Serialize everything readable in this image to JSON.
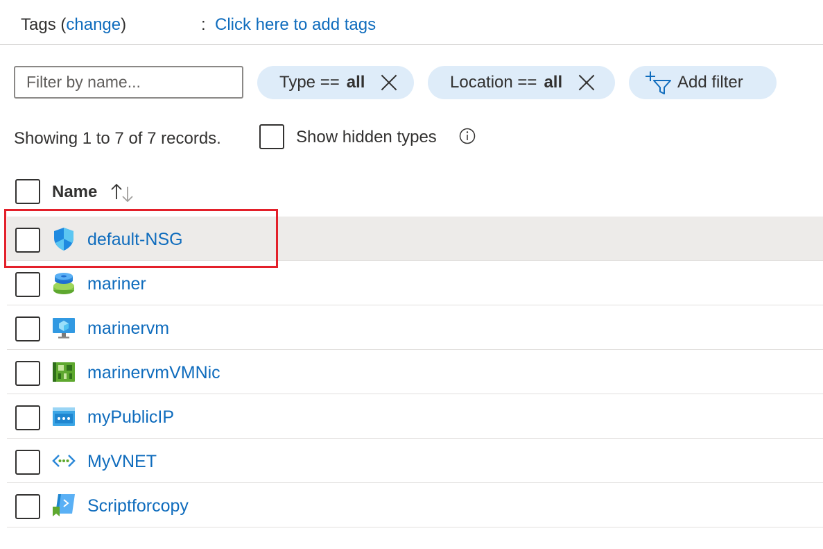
{
  "tags": {
    "label": "Tags",
    "open_paren": "(",
    "change_link": "change",
    "close_paren": ")",
    "colon": ":",
    "add_link": "Click here to add tags"
  },
  "filters": {
    "search_placeholder": "Filter by name...",
    "type_pill": {
      "key": "Type ==",
      "value": "all"
    },
    "location_pill": {
      "key": "Location ==",
      "value": "all"
    },
    "add_filter_label": "Add filter"
  },
  "summary": {
    "records_text": "Showing 1 to 7 of 7 records.",
    "show_hidden_label": "Show hidden types"
  },
  "table": {
    "column_name": "Name",
    "rows": [
      {
        "name": "default-NSG",
        "icon": "network-security-group-icon",
        "selected": true
      },
      {
        "name": "mariner",
        "icon": "disk-icon"
      },
      {
        "name": "marinervm",
        "icon": "virtual-machine-icon"
      },
      {
        "name": "marinervmVMNic",
        "icon": "network-interface-icon"
      },
      {
        "name": "myPublicIP",
        "icon": "public-ip-icon"
      },
      {
        "name": "MyVNET",
        "icon": "virtual-network-icon"
      },
      {
        "name": "Scriptforcopy",
        "icon": "script-icon"
      }
    ]
  },
  "colors": {
    "link": "#0f6cbd",
    "pill_bg": "#deecf9",
    "selected_row_bg": "#edebe9",
    "highlight_border": "#e3202a"
  }
}
